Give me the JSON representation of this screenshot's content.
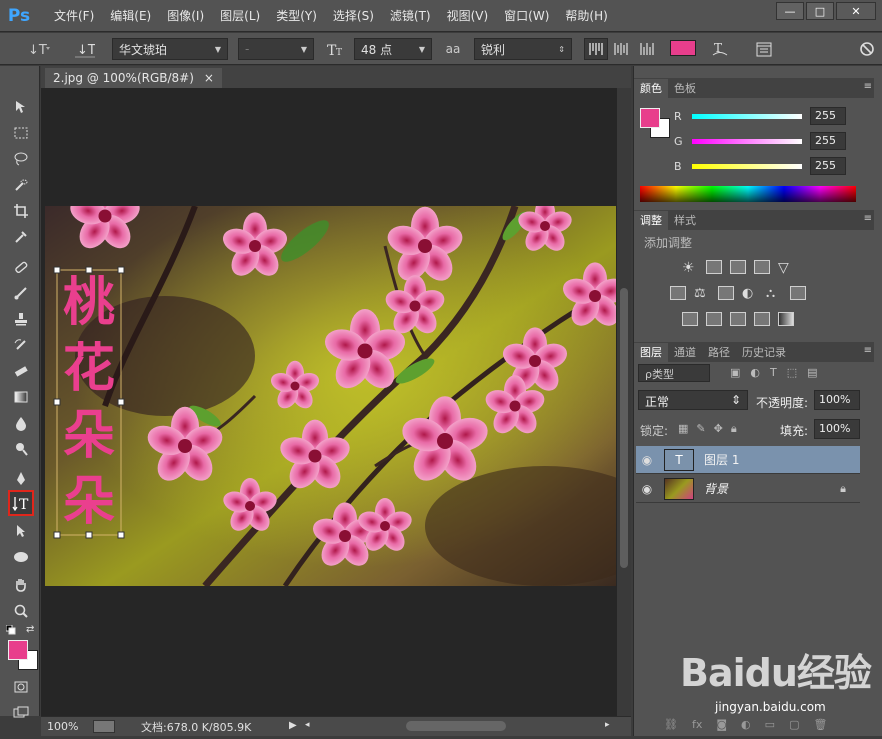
{
  "app": {
    "logo": "Ps"
  },
  "menu": [
    "文件(F)",
    "编辑(E)",
    "图像(I)",
    "图层(L)",
    "类型(Y)",
    "选择(S)",
    "滤镜(T)",
    "视图(V)",
    "窗口(W)",
    "帮助(H)"
  ],
  "window_controls": {
    "minimize": "—",
    "maximize": "□",
    "close": "✕"
  },
  "options": {
    "font_family": "华文琥珀",
    "font_style": "-",
    "font_size": "48 点",
    "antialias_icon": "aa",
    "antialias": "锐利",
    "text_color": "#e83e8c"
  },
  "document": {
    "tab_title": "2.jpg @ 100%(RGB/8#)",
    "tab_close": "×",
    "text_layer_content": [
      "桃",
      "花",
      "朵",
      "朵"
    ],
    "text_color": "#ea3f8e"
  },
  "status": {
    "zoom": "100%",
    "doc_info": "文档:678.0 K/805.9K"
  },
  "colors": {
    "foreground": "#e83e8c",
    "background": "#ffffff"
  },
  "color_panel": {
    "tabs": [
      "颜色",
      "色板"
    ],
    "r_label": "R",
    "r_value": "255",
    "g_label": "G",
    "g_value": "255",
    "b_label": "B",
    "b_value": "255"
  },
  "adjust_panel": {
    "tabs": [
      "调整",
      "样式"
    ],
    "title": "添加调整"
  },
  "layers_panel": {
    "tabs": [
      "图层",
      "通道",
      "路径",
      "历史记录"
    ],
    "filter": "ρ类型",
    "blend_mode": "正常",
    "opacity_label": "不透明度:",
    "opacity_value": "100%",
    "lock_label": "锁定:",
    "fill_label": "填充:",
    "fill_value": "100%",
    "layers": [
      {
        "name": "图层 1",
        "thumb": "T",
        "selected": true
      },
      {
        "name": "背景",
        "thumb": "",
        "selected": false
      }
    ]
  },
  "watermark": {
    "logo": "Baidu经验",
    "url": "jingyan.baidu.com"
  }
}
